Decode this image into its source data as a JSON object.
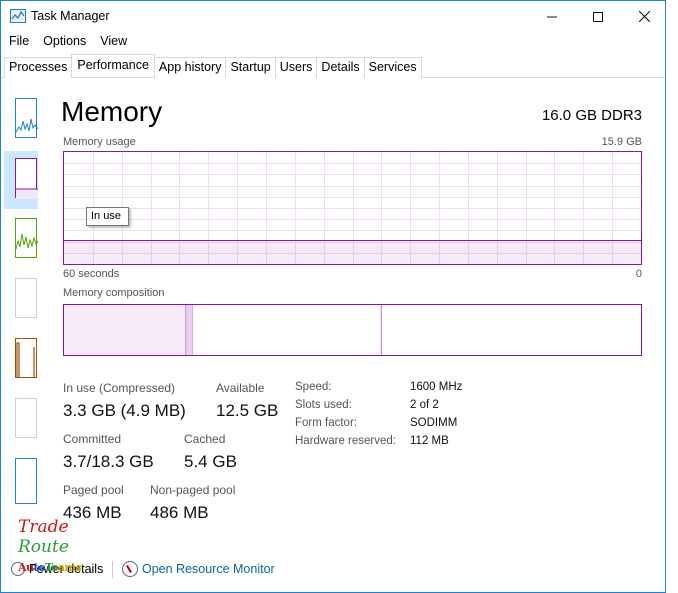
{
  "window": {
    "title": "Task Manager",
    "controls": {
      "minimize": "—",
      "maximize": "☐",
      "close": "✕"
    }
  },
  "menu": {
    "file": "File",
    "options": "Options",
    "view": "View"
  },
  "tabs": [
    "Processes",
    "Performance",
    "App history",
    "Startup",
    "Users",
    "Details",
    "Services"
  ],
  "active_tab": "Performance",
  "header": {
    "title": "Memory",
    "spec": "16.0 GB DDR3"
  },
  "usage_graph": {
    "label": "Memory usage",
    "max_label": "15.9 GB",
    "time_left": "60 seconds",
    "time_right": "0",
    "tooltip": "In use",
    "in_use_fraction": 0.21
  },
  "composition": {
    "label": "Memory composition",
    "in_use_fraction": 0.21,
    "modified_fraction": 0.012,
    "standby_fraction": 0.327
  },
  "stats": {
    "in_use_label": "In use (Compressed)",
    "in_use_value": "3.3 GB (4.9 MB)",
    "available_label": "Available",
    "available_value": "12.5 GB",
    "committed_label": "Committed",
    "committed_value": "3.7/18.3 GB",
    "cached_label": "Cached",
    "cached_value": "5.4 GB",
    "paged_label": "Paged pool",
    "paged_value": "436 MB",
    "nonpaged_label": "Non-paged pool",
    "nonpaged_value": "486 MB"
  },
  "details": [
    {
      "label": "Speed:",
      "value": "1600 MHz"
    },
    {
      "label": "Slots used:",
      "value": "2 of 2"
    },
    {
      "label": "Form factor:",
      "value": "SODIMM"
    },
    {
      "label": "Hardware reserved:",
      "value": "112 MB"
    }
  ],
  "footer": {
    "fewer_details": "Fewer details",
    "open_resource_monitor": "Open Resource Monitor"
  },
  "watermark": {
    "line1": "Trade",
    "line2": "Route",
    "line3": "AutoTeams"
  },
  "colors": {
    "memory_accent": "#8b12ae",
    "cpu_accent": "#1a86c7",
    "disk_accent": "#4da60c",
    "ethernet_accent": "#a74f01",
    "selection": "#cce8ff",
    "link": "#0a64a4"
  }
}
